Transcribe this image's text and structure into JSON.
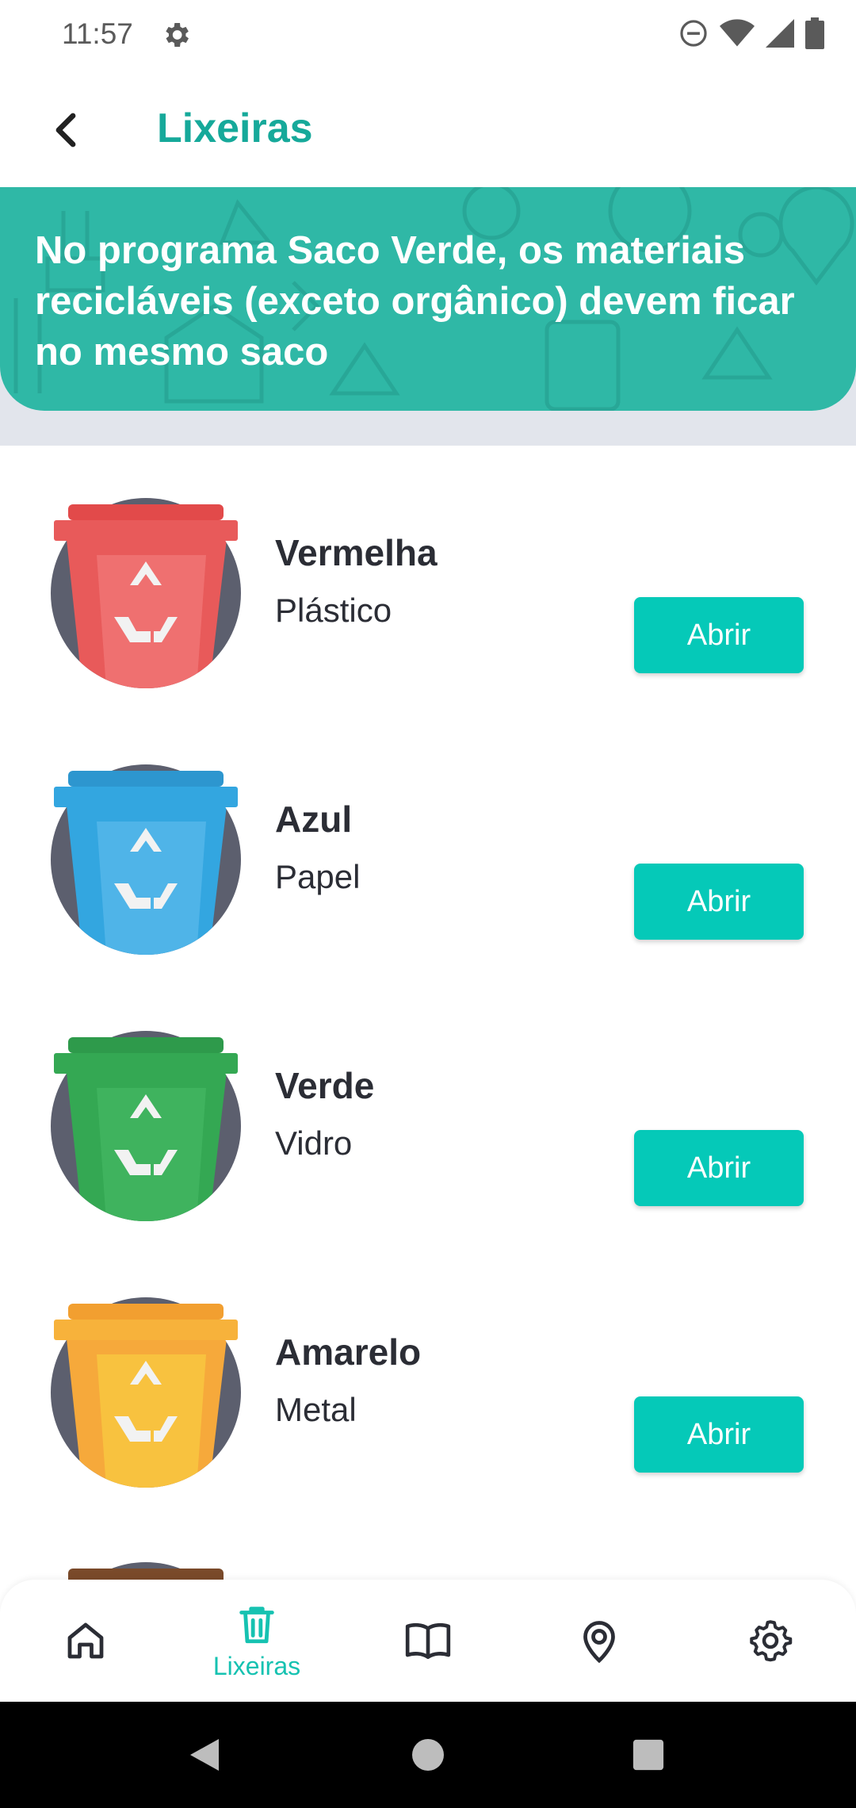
{
  "status_bar": {
    "time": "11:57"
  },
  "app_bar": {
    "title": "Lixeiras"
  },
  "banner": {
    "text": "No programa Saco Verde, os materiais recicláveis (exceto orgânico) devem ficar no mesmo saco"
  },
  "bins": [
    {
      "name": "Vermelha",
      "material": "Plástico",
      "button": "Abrir",
      "color": "#e85a5a"
    },
    {
      "name": "Azul",
      "material": "Papel",
      "button": "Abrir",
      "color": "#33a6e0"
    },
    {
      "name": "Verde",
      "material": "Vidro",
      "button": "Abrir",
      "color": "#34a853"
    },
    {
      "name": "Amarelo",
      "material": "Metal",
      "button": "Abrir",
      "color": "#f6b93b"
    }
  ],
  "bottom_nav": {
    "items": [
      {
        "icon": "home-icon",
        "label": ""
      },
      {
        "icon": "trash-icon",
        "label": "Lixeiras",
        "active": true
      },
      {
        "icon": "book-icon",
        "label": ""
      },
      {
        "icon": "location-icon",
        "label": ""
      },
      {
        "icon": "settings-icon",
        "label": ""
      }
    ]
  },
  "colors": {
    "accent": "#16a99a",
    "button": "#05c9b8",
    "banner": "#2fb8a6"
  }
}
